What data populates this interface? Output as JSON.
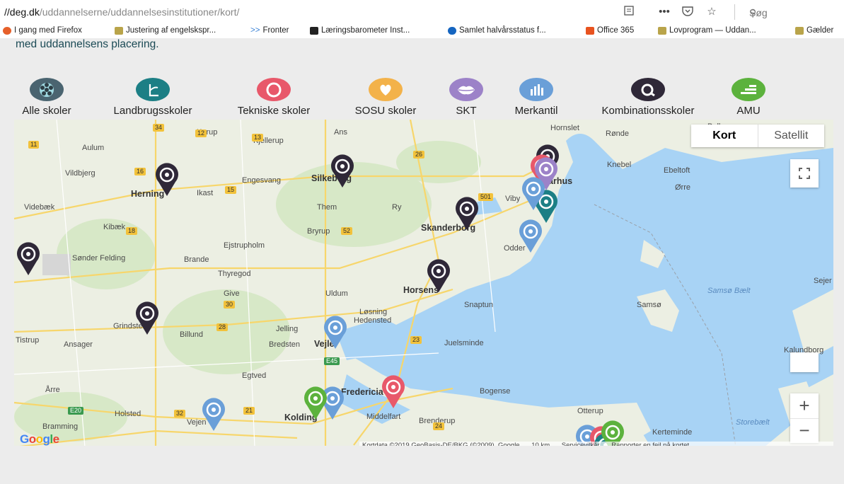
{
  "browser": {
    "url_prefix": "//deg.dk",
    "url_path": "/uddannelserne/uddannelsesinstitutioner/kort/",
    "search_placeholder": "Søg",
    "bookmarks": [
      {
        "label": "I gang med Firefox",
        "color": "#e6602a"
      },
      {
        "label": "Justering af engelskspr...",
        "color": "#8a7a33"
      },
      {
        "label": "Fronter",
        "color": "#3b82d6",
        "prefix": ">>"
      },
      {
        "label": "Læringsbarometer Inst...",
        "color": "#222222"
      },
      {
        "label": "Samlet halvårsstatus f...",
        "color": "#1565c0"
      },
      {
        "label": "Office 365",
        "color": "#e8531f"
      },
      {
        "label": "Lovprogram — Uddan...",
        "color": "#8a7a33"
      },
      {
        "label": "Gælder",
        "color": "#8a7a33"
      }
    ]
  },
  "page": {
    "lead_text": "med uddannelsens placering."
  },
  "categories": [
    {
      "label": "Alle skoler",
      "color": "#4a6470",
      "icon": "all-schools-icon"
    },
    {
      "label": "Landbrugsskoler",
      "color": "#1c7f85",
      "icon": "agriculture-icon"
    },
    {
      "label": "Tekniske skoler",
      "color": "#e8586a",
      "icon": "technical-icon"
    },
    {
      "label": "SOSU skoler",
      "color": "#f3b24a",
      "icon": "heart-icon"
    },
    {
      "label": "SKT",
      "color": "#9c82c8",
      "icon": "lips-icon"
    },
    {
      "label": "Merkantil",
      "color": "#6a9fd8",
      "icon": "bar-chart-icon"
    },
    {
      "label": "Kombinationsskoler",
      "color": "#2f2838",
      "icon": "combination-icon"
    },
    {
      "label": "AMU",
      "color": "#5cb23d",
      "icon": "amu-icon"
    }
  ],
  "map": {
    "type_buttons": {
      "map": "Kort",
      "satellite": "Satellit"
    },
    "zoom_in": "+",
    "zoom_out": "−",
    "google": "Google",
    "attribution": {
      "data": "Kortdata ©2019 GeoBasis-DE/BKG (©2009), Google",
      "scale": "10 km",
      "terms": "Servicevilkår",
      "report": "Rapporter en fejl på kortet"
    },
    "places": [
      "Herning",
      "Ikast",
      "Silkeborg",
      "Engesvang",
      "Kjellerup",
      "Aulum",
      "Vildbjerg",
      "Karup",
      "Ans",
      "Hornslet",
      "Rønde",
      "Ebeltoft",
      "Knebel",
      "Ørre",
      "Balle",
      "Aarhus",
      "Viby",
      "Skanderborg",
      "Odder",
      "Ry",
      "Them",
      "Bryrup",
      "Ejstrupholm",
      "Brande",
      "Thyregod",
      "Sønder Felding",
      "Kibæk",
      "Videbæk",
      "Horsens",
      "Give",
      "Uldum",
      "Løsning",
      "Hedensted",
      "Snaptun",
      "Samsø",
      "Samsø Bælt",
      "Sejer",
      "Kalundborg",
      "Grindsted",
      "Billund",
      "Jelling",
      "Vejle",
      "Bredsten",
      "Juelsminde",
      "Tistrup",
      "Ansager",
      "Egtved",
      "Fredericia",
      "Bogense",
      "Middelfart",
      "Brenderup",
      "Kolding",
      "Holsted",
      "Vejen",
      "Bramming",
      "Årre",
      "Otterup",
      "Kerteminde",
      "Storebælt"
    ],
    "roads": [
      "34",
      "12",
      "13",
      "11",
      "18",
      "16",
      "15",
      "26",
      "501",
      "52",
      "28",
      "30",
      "23",
      "E45",
      "E20",
      "32",
      "24",
      "21"
    ]
  }
}
